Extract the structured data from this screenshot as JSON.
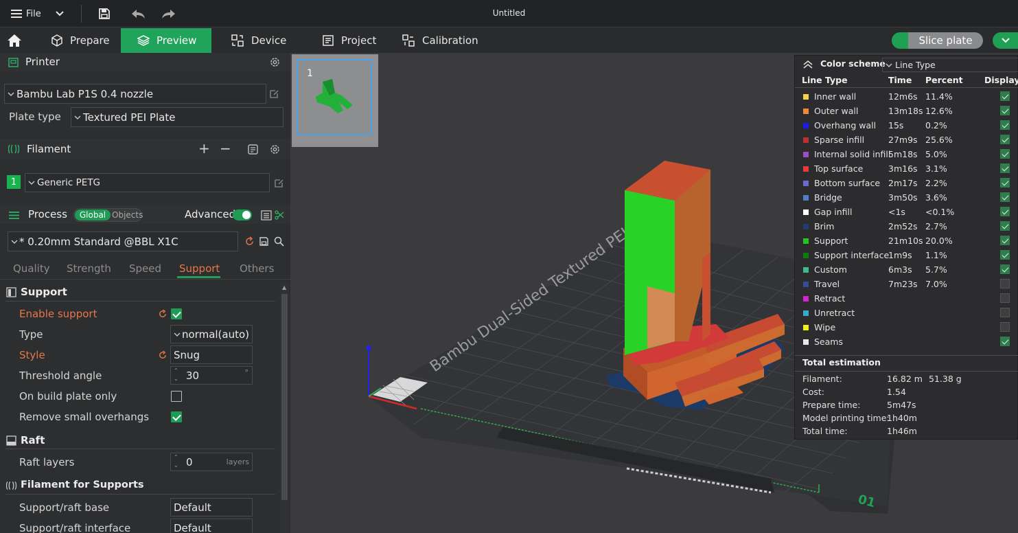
{
  "window": {
    "title": "Untitled",
    "file_menu": "File"
  },
  "tabs": [
    "Prepare",
    "Preview",
    "Device",
    "Project",
    "Calibration"
  ],
  "slice_button": "Slice plate",
  "printer": {
    "header": "Printer",
    "name": "Bambu Lab P1S 0.4 nozzle",
    "plate_type_label": "Plate type",
    "plate_type": "Textured PEI Plate"
  },
  "filament": {
    "header": "Filament",
    "slot": "1",
    "name": "Generic PETG"
  },
  "process": {
    "header": "Process",
    "toggle_global": "Global",
    "toggle_objects": "Objects",
    "advanced_label": "Advanced",
    "preset": "* 0.20mm Standard @BBL X1C",
    "subtabs": [
      "Quality",
      "Strength",
      "Speed",
      "Support",
      "Others"
    ],
    "active_subtab": "Support"
  },
  "support": {
    "header": "Support",
    "enable_label": "Enable support",
    "type_label": "Type",
    "type_value": "normal(auto)",
    "style_label": "Style",
    "style_value": "Snug",
    "threshold_label": "Threshold angle",
    "threshold_value": "30",
    "threshold_unit": "°",
    "build_plate_only_label": "On build plate only",
    "remove_small_label": "Remove small overhangs"
  },
  "raft": {
    "header": "Raft",
    "layers_label": "Raft layers",
    "layers_value": "0",
    "layers_unit": "layers"
  },
  "filament_supports": {
    "header": "Filament for Supports",
    "base_label": "Support/raft base",
    "base_value": "Default",
    "interface_label": "Support/raft interface",
    "interface_value": "Default"
  },
  "plate_thumb": {
    "number": "1"
  },
  "bed": {
    "text": "Bambu Dual-Sided Textured PEI Plate",
    "corner_number": "01"
  },
  "legend": {
    "title": "Color scheme",
    "scheme": "Line Type",
    "columns": [
      "Line Type",
      "Time",
      "Percent",
      "Display"
    ],
    "rows": [
      {
        "name": "Inner wall",
        "time": "12m6s",
        "percent": "11.4%",
        "color": "#f2d04a",
        "display": true
      },
      {
        "name": "Outer wall",
        "time": "13m18s",
        "percent": "12.6%",
        "color": "#f08a3a",
        "display": true
      },
      {
        "name": "Overhang wall",
        "time": "15s",
        "percent": "0.2%",
        "color": "#1a1aee",
        "display": true
      },
      {
        "name": "Sparse infill",
        "time": "27m9s",
        "percent": "25.6%",
        "color": "#b83232",
        "display": true
      },
      {
        "name": "Internal solid infill",
        "time": "5m18s",
        "percent": "5.0%",
        "color": "#9a4fc6",
        "display": true
      },
      {
        "name": "Top surface",
        "time": "3m16s",
        "percent": "3.1%",
        "color": "#e23c3c",
        "display": true
      },
      {
        "name": "Bottom surface",
        "time": "2m17s",
        "percent": "2.2%",
        "color": "#6a6ad2",
        "display": true
      },
      {
        "name": "Bridge",
        "time": "3m50s",
        "percent": "3.6%",
        "color": "#4d7ec2",
        "display": true
      },
      {
        "name": "Gap infill",
        "time": "<1s",
        "percent": "<0.1%",
        "color": "#ffffff",
        "display": true
      },
      {
        "name": "Brim",
        "time": "2m52s",
        "percent": "2.7%",
        "color": "#1d3f6e",
        "display": true
      },
      {
        "name": "Support",
        "time": "21m10s",
        "percent": "20.0%",
        "color": "#22c322",
        "display": true
      },
      {
        "name": "Support interface",
        "time": "1m9s",
        "percent": "1.1%",
        "color": "#0e7a0e",
        "display": true
      },
      {
        "name": "Custom",
        "time": "6m3s",
        "percent": "5.7%",
        "color": "#3fb98a",
        "display": true
      },
      {
        "name": "Travel",
        "time": "7m23s",
        "percent": "7.0%",
        "color": "#3b4a9a",
        "display": false
      },
      {
        "name": "Retract",
        "time": "",
        "percent": "",
        "color": "#d323d3",
        "display": false
      },
      {
        "name": "Unretract",
        "time": "",
        "percent": "",
        "color": "#3aa9c9",
        "display": false
      },
      {
        "name": "Wipe",
        "time": "",
        "percent": "",
        "color": "#f2ee1a",
        "display": false
      },
      {
        "name": "Seams",
        "time": "",
        "percent": "",
        "color": "#e8e8e8",
        "display": true
      }
    ],
    "total_title": "Total estimation",
    "filament_label": "Filament:",
    "filament_length": "16.82 m",
    "filament_weight": "51.38 g",
    "cost_label": "Cost:",
    "cost_value": "1.54",
    "prepare_label": "Prepare time:",
    "prepare_value": "5m47s",
    "model_label": "Model printing time:",
    "model_value": "1h40m",
    "total_label": "Total time:",
    "total_value": "1h46m"
  }
}
